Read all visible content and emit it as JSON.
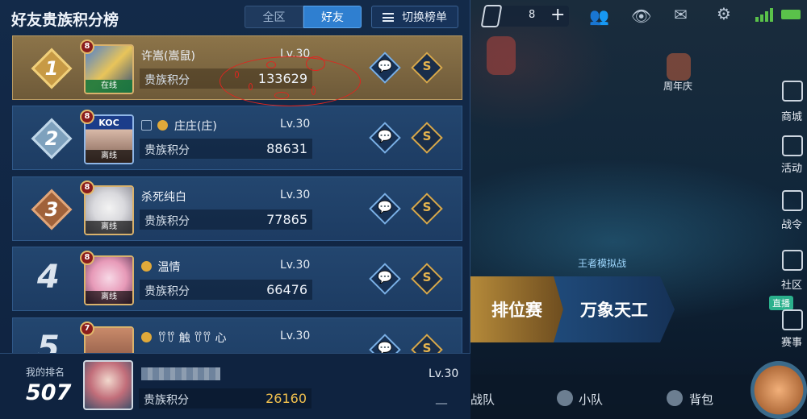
{
  "colors": {
    "accent": "#2f7fd0",
    "gold_row": "#8c7449",
    "row": "#23466f",
    "score_highlight": "#f2c14e",
    "annotation": "#e0251f"
  },
  "header": {
    "title": "好友贵族积分榜",
    "tabs": [
      {
        "label": "全区",
        "selected": false
      },
      {
        "label": "好友",
        "selected": true
      }
    ],
    "switch_label": "切换榜单",
    "switch_icon": "list-icon"
  },
  "score_label": "贵族积分",
  "entries": [
    {
      "rank": "1",
      "vip": "8",
      "name": "许嵩(嵩鼠)",
      "level": "Lv.30",
      "score": "133629",
      "status": "在线"
    },
    {
      "rank": "2",
      "vip": "8",
      "name": "庄庄(庄)",
      "level": "Lv.30",
      "score": "88631",
      "status": "离线",
      "avatar_text": "KOC"
    },
    {
      "rank": "3",
      "vip": "8",
      "name": "杀死纯白",
      "level": "Lv.30",
      "score": "77865",
      "status": "离线"
    },
    {
      "rank": "4",
      "vip": "8",
      "name": "温情",
      "level": "Lv.30",
      "score": "66476",
      "status": "离线"
    },
    {
      "rank": "5",
      "vip": "7",
      "name": "ꀎꀎ 触 ꀎꀎ 心",
      "level": "Lv.30"
    }
  ],
  "my_rank": {
    "label": "我的排名",
    "value": "507",
    "level": "Lv.30",
    "score": "26160",
    "trailing": "__"
  },
  "game_ui": {
    "coin_count": "8",
    "lobby_labels": {
      "anniversary": "周年庆",
      "shop": "商城",
      "activity": "活动",
      "battle": "战令",
      "community": "社区",
      "live": "直播",
      "events": "赛事",
      "simulator": "王者模拟战"
    },
    "modes": {
      "ranked": "排位赛",
      "wanxiang": "万象天工"
    },
    "bottom_nav": {
      "team_battle": "战队",
      "squad": "小队",
      "backpack": "背包"
    }
  }
}
